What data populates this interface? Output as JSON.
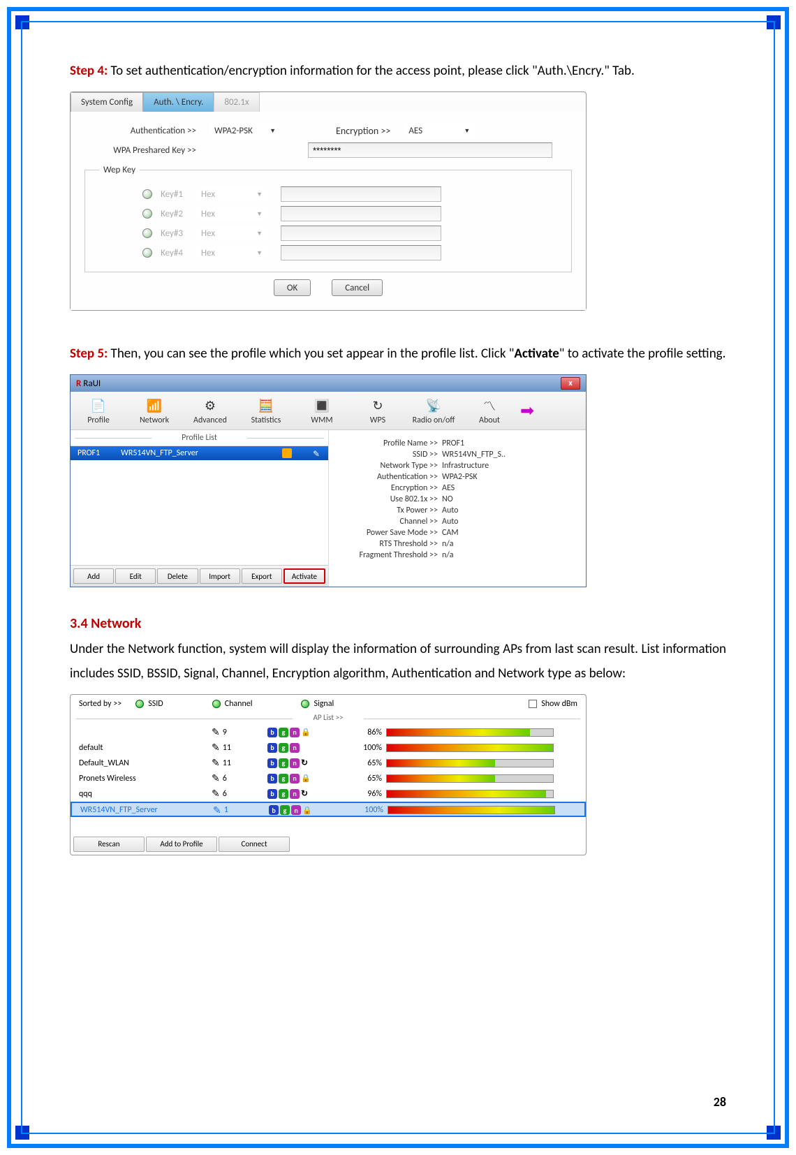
{
  "page_number": "28",
  "step4_label": "Step 4:",
  "step4_text": " To set authentication/encryption information for the access point, please click \"Auth.\\Encry.\" Tab.",
  "step5_label": "Step 5:",
  "step5_text_a": " Then, you can see the profile which you set appear in the profile list. Click \"",
  "step5_text_b": "Activate",
  "step5_text_c": "\" to activate the profile setting.",
  "section_heading": "3.4 Network",
  "section_body": "Under the Network function, system will display the information of surrounding APs from last scan result. List information includes SSID, BSSID, Signal, Channel, Encryption algorithm, Authentication and Network type as below:",
  "panel1": {
    "tabs": {
      "system_config": "System Config",
      "auth_encry": "Auth. \\ Encry.",
      "dot1x": "802.1x"
    },
    "auth_label": "Authentication >>",
    "auth_value": "WPA2-PSK",
    "encry_label": "Encryption >>",
    "encry_value": "AES",
    "psk_label": "WPA Preshared Key >>",
    "psk_value": "********",
    "wep_legend": "Wep Key",
    "key_rows": [
      {
        "label": "Key#1",
        "type": "Hex"
      },
      {
        "label": "Key#2",
        "type": "Hex"
      },
      {
        "label": "Key#3",
        "type": "Hex"
      },
      {
        "label": "Key#4",
        "type": "Hex"
      }
    ],
    "ok": "OK",
    "cancel": "Cancel"
  },
  "panel2": {
    "title": "RaUI",
    "toolbar": [
      "Profile",
      "Network",
      "Advanced",
      "Statistics",
      "WMM",
      "WPS",
      "Radio on/off",
      "About"
    ],
    "profile_list_label": "Profile List",
    "profile_row": {
      "name": "PROF1",
      "ssid": "WR514VN_FTP_Server"
    },
    "profile_buttons": {
      "add": "Add",
      "edit": "Edit",
      "delete": "Delete",
      "import": "Import",
      "export": "Export",
      "activate": "Activate"
    },
    "details": [
      {
        "k": "Profile Name >>",
        "v": "PROF1"
      },
      {
        "k": "SSID >>",
        "v": "WR514VN_FTP_S.."
      },
      {
        "k": "Network Type >>",
        "v": "Infrastructure"
      },
      {
        "k": "Authentication >>",
        "v": "WPA2-PSK"
      },
      {
        "k": "Encryption >>",
        "v": "AES"
      },
      {
        "k": "Use 802.1x >>",
        "v": "NO"
      },
      {
        "k": "Tx Power >>",
        "v": "Auto"
      },
      {
        "k": "Channel >>",
        "v": "Auto"
      },
      {
        "k": "Power Save Mode >>",
        "v": "CAM"
      },
      {
        "k": "RTS Threshold >>",
        "v": "n/a"
      },
      {
        "k": "Fragment Threshold >>",
        "v": "n/a"
      }
    ]
  },
  "panel3": {
    "sorted_by": "Sorted by >>",
    "opt_ssid": "SSID",
    "opt_channel": "Channel",
    "opt_signal": "Signal",
    "show_dbm": "Show dBm",
    "ap_list_label": "AP List >>",
    "rows": [
      {
        "ssid": "",
        "ch": "9",
        "modes": "bgn",
        "extra": "lock",
        "signal": "86%",
        "pct": 86
      },
      {
        "ssid": "default",
        "ch": "11",
        "modes": "bgn",
        "extra": "",
        "signal": "100%",
        "pct": 100
      },
      {
        "ssid": "Default_WLAN",
        "ch": "11",
        "modes": "bgn",
        "extra": "refresh",
        "signal": "65%",
        "pct": 65
      },
      {
        "ssid": "Pronets Wireless",
        "ch": "6",
        "modes": "bgn",
        "extra": "lock",
        "signal": "65%",
        "pct": 65
      },
      {
        "ssid": "qqq",
        "ch": "6",
        "modes": "bgn",
        "extra": "refresh",
        "signal": "96%",
        "pct": 96
      },
      {
        "ssid": "WR514VN_FTP_Server",
        "ch": "1",
        "modes": "bgn",
        "extra": "lock",
        "signal": "100%",
        "pct": 100,
        "selected": true
      }
    ],
    "buttons": {
      "rescan": "Rescan",
      "add_to_profile": "Add to Profile",
      "connect": "Connect"
    }
  }
}
